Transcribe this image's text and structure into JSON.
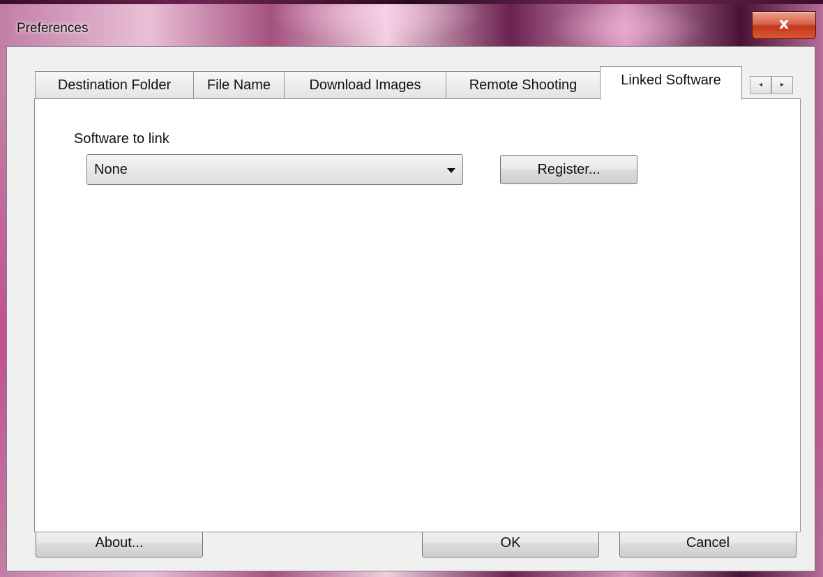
{
  "window": {
    "title": "Preferences",
    "close_glyph": "x"
  },
  "tabs": [
    {
      "label": "Destination Folder",
      "active": false
    },
    {
      "label": "File Name",
      "active": false
    },
    {
      "label": "Download Images",
      "active": false
    },
    {
      "label": "Remote Shooting",
      "active": false
    },
    {
      "label": "Linked Software",
      "active": true
    }
  ],
  "tab_scroll": {
    "left_glyph": "◂",
    "right_glyph": "▸"
  },
  "linked_software": {
    "label": "Software to link",
    "selected_value": "None",
    "register_button": "Register..."
  },
  "footer": {
    "about_button": "About...",
    "ok_button": "OK",
    "cancel_button": "Cancel"
  },
  "icons": {
    "close": "close-icon",
    "dropdown": "chevron-down-icon",
    "tab_left": "chevron-left-icon",
    "tab_right": "chevron-right-icon"
  }
}
